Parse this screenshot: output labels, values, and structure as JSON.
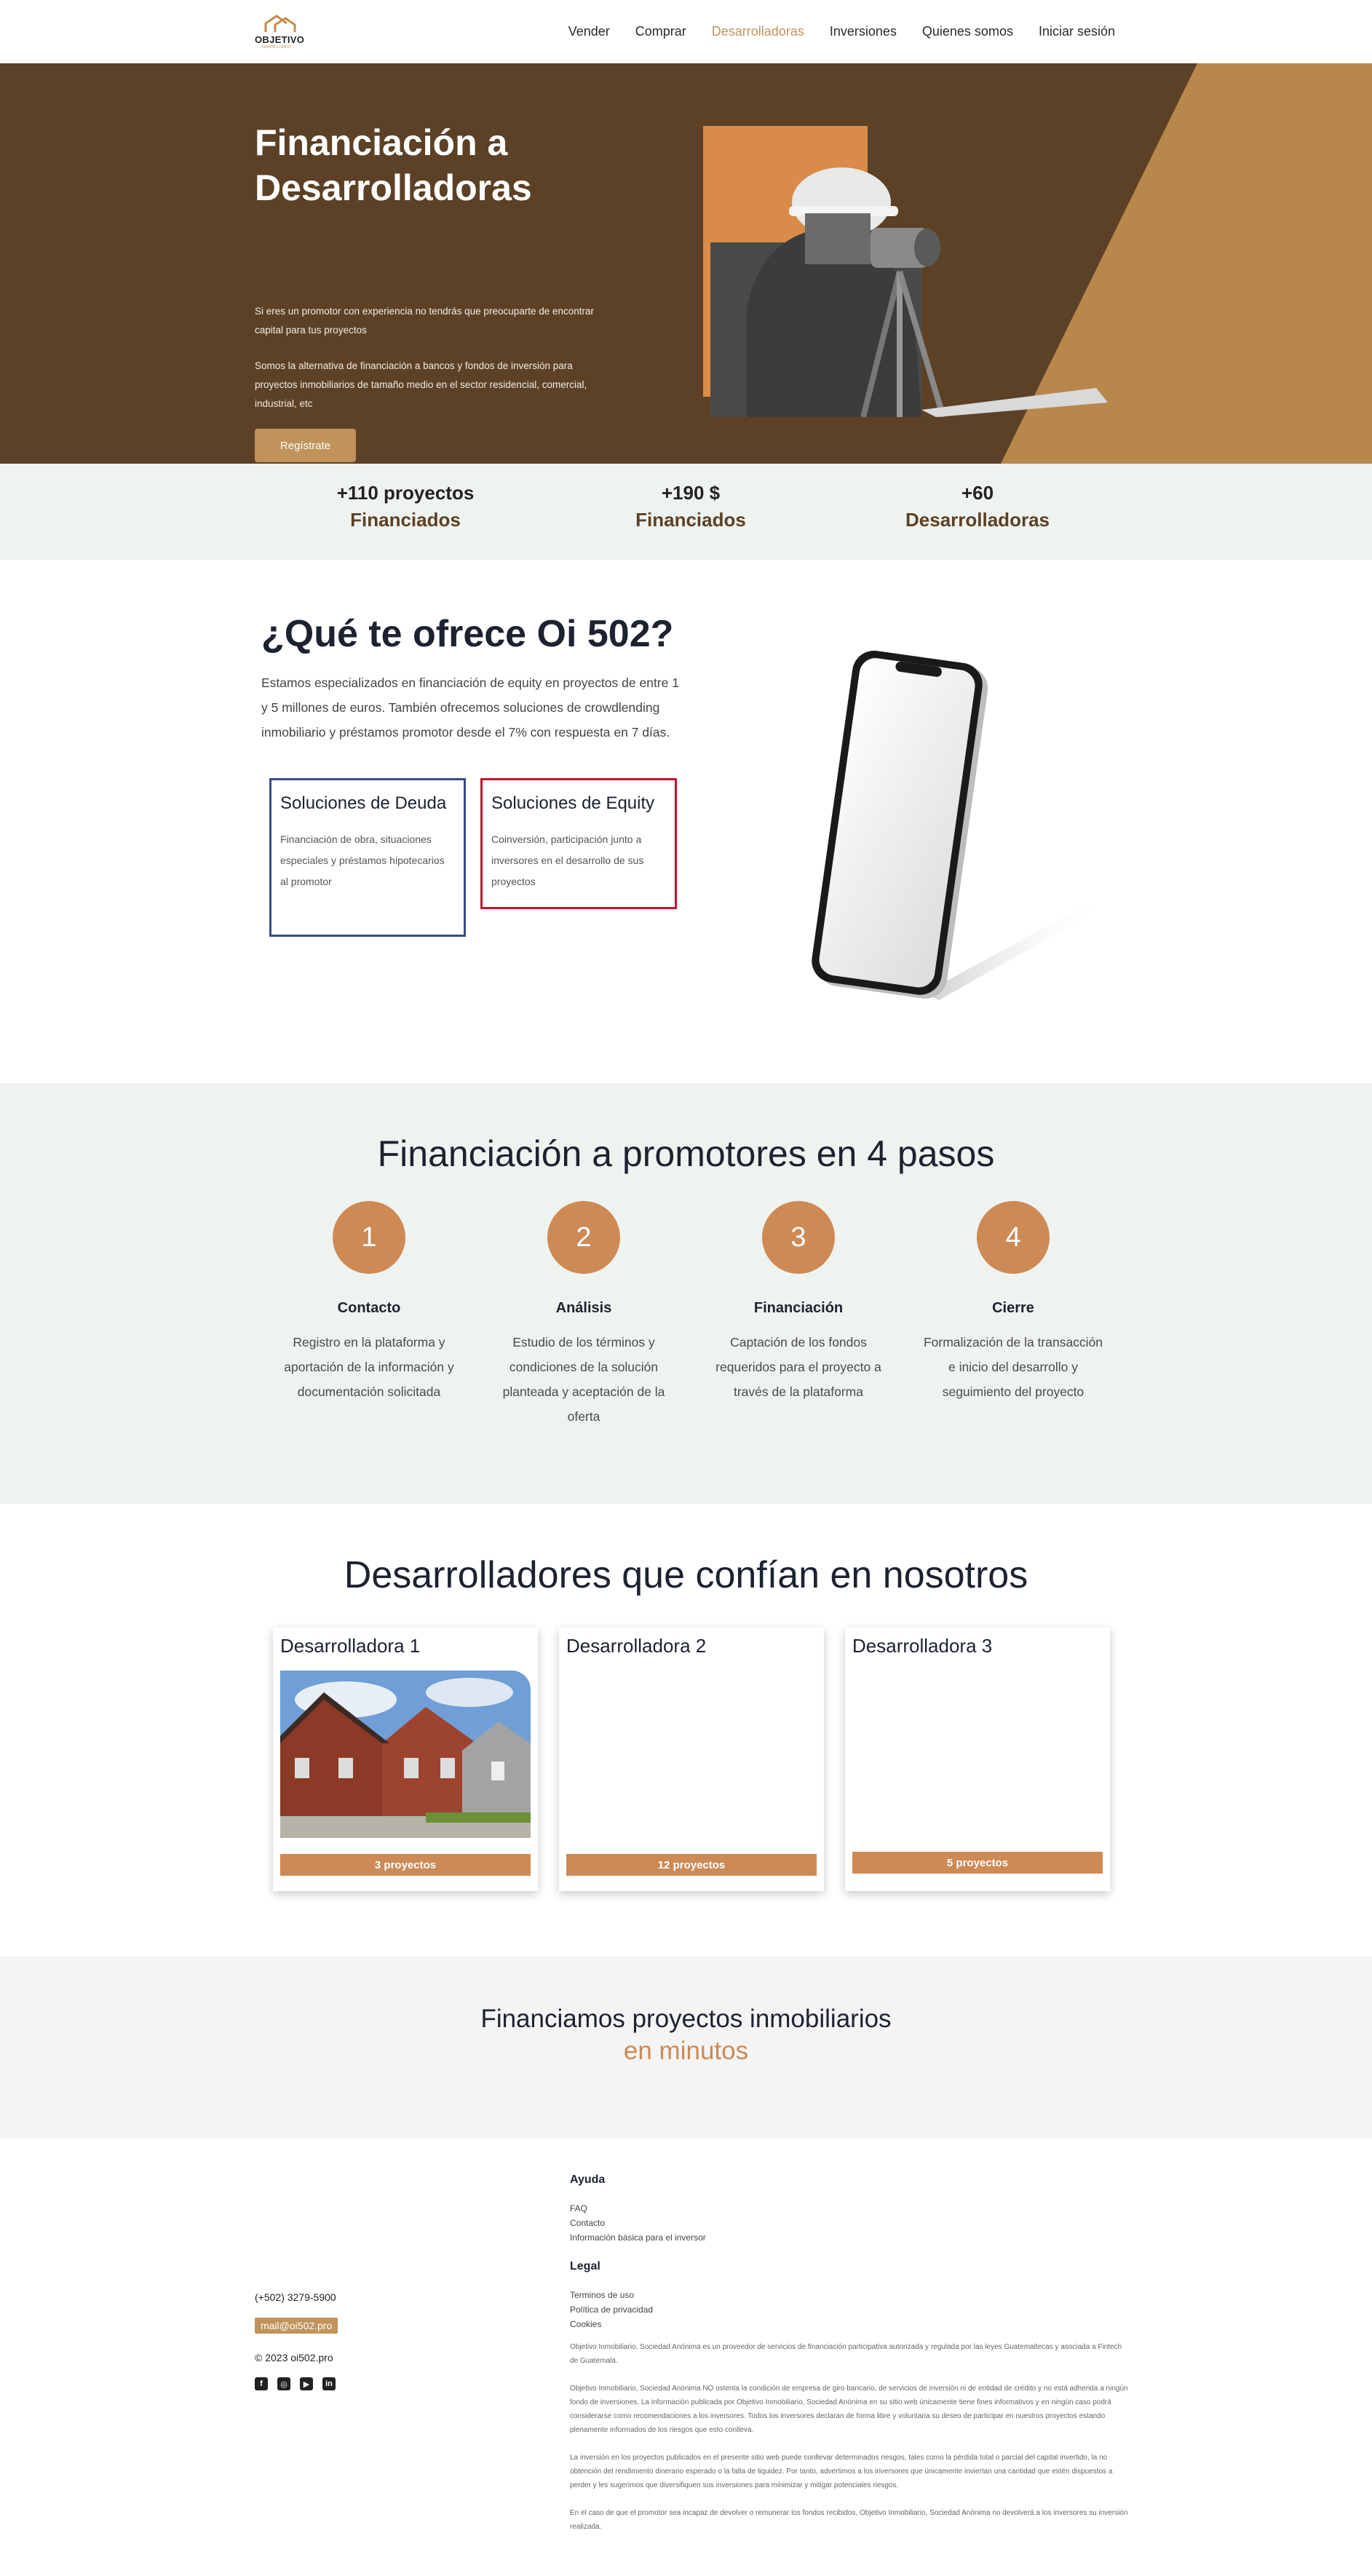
{
  "brand": {
    "name": "OBJETIVO",
    "tagline": "INMOBILIARIO",
    "accent": "#c0935a",
    "brown": "#5c4126",
    "orange": "#cd8a55"
  },
  "nav": {
    "items": [
      {
        "label": "Vender",
        "active": false
      },
      {
        "label": "Comprar",
        "active": false
      },
      {
        "label": "Desarrolladoras",
        "active": true
      },
      {
        "label": "Inversiones",
        "active": false
      },
      {
        "label": "Quienes somos",
        "active": false
      },
      {
        "label": "Iniciar sesión",
        "active": false
      }
    ]
  },
  "hero": {
    "title": "Financiación a Desarrolladoras",
    "p1": "Si eres un promotor con experiencia no tendrás que preocuparte de encontrar capital para tus proyectos",
    "p2": "Somos la alternativa de financiación a bancos y fondos de inversión para proyectos inmobiliarios de tamaño medio en el sector residencial, comercial, industrial, etc",
    "button": "Regístrate"
  },
  "stats": [
    {
      "num": "+110 proyectos",
      "label": "Financiados"
    },
    {
      "num": "+190 $",
      "label": "Financiados"
    },
    {
      "num": "+60",
      "label": "Desarrolladoras"
    }
  ],
  "offer": {
    "title": "¿Qué te ofrece Oi 502?",
    "intro": "Estamos especializados en financiación de equity en proyectos de entre 1 y 5 millones de euros. También ofrecemos soluciones de crowdlending inmobiliario y préstamos promotor desde el 7% con respuesta en 7 días.",
    "cards": [
      {
        "title": "Soluciones de Deuda",
        "text": "Financiación de obra, situaciones especiales y préstamos hipotecarios al promotor"
      },
      {
        "title": "Soluciones de Equity",
        "text": "Coinversión, participación junto a inversores en el desarrollo de sus proyectos"
      }
    ]
  },
  "steps": {
    "title": "Financiación a promotores en 4 pasos",
    "items": [
      {
        "n": "1",
        "title": "Contacto",
        "text": "Registro en la plataforma y aportación de la información y documentación solicitada"
      },
      {
        "n": "2",
        "title": "Análisis",
        "text": "Estudio de los términos y condiciones de la solución planteada y aceptación de la oferta"
      },
      {
        "n": "3",
        "title": "Financiación",
        "text": "Captación de los fondos requeridos para el proyecto a través de la plataforma"
      },
      {
        "n": "4",
        "title": "Cierre",
        "text": "Formalización de la transacción e inicio del desarrollo y seguimiento del proyecto"
      }
    ]
  },
  "devs": {
    "title": "Desarrolladores que confían en nosotros",
    "cards": [
      {
        "name": "Desarrolladora 1",
        "projects": "3 proyectos"
      },
      {
        "name": "Desarrolladora 2",
        "projects": "12 proyectos"
      },
      {
        "name": "Desarrolladora 3",
        "projects": "5 proyectos"
      }
    ]
  },
  "cta": {
    "line1": "Financiamos proyectos inmobiliarios",
    "line2": "en minutos"
  },
  "footer": {
    "phone": "(+502) 3279-5900",
    "email": "mail@oi502.pro",
    "copyright": "© 2023 oi502.pro",
    "help_title": "Ayuda",
    "help_links": [
      "FAQ",
      "Contacto",
      "Información básica para el inversor"
    ],
    "legal_title": "Legal",
    "legal_links": [
      "Terminos de uso",
      "Política de privacidad",
      "Cookies"
    ],
    "legal_texts": [
      "Objetivo Inmobiliario, Sociedad Anónima es un proveedor de servicios de financiación participativa autorizada y regulada por las leyes Guatemaltecas y asociada a Fintech de Guatemala.",
      "Objetivo Inmobiliario, Sociedad Anónima NO ostenta la condición de empresa de giro bancario, de servicios de inversión ni de entidad de crédito y no está adherida a ningún fondo de inversiones. La información publicada por Objetivo Inmobiliario, Sociedad Anónima en su sitio web únicamente tiene fines informativos y en ningún caso podrá considerarse como recomendaciones a los inversores. Todos los inversores declaran de forma libre y voluntaria su deseo de participar en nuestros proyectos estando plenamente informados de los riesgos que esto conlleva.",
      "La inversión en los proyectos publicados en el presente sitio web puede conllevar determinados riesgos, tales como la pérdida total o parcial del capital invertido, la no obtención del rendimiento dinerario esperado o la falta de liquidez. Por tanto, advertimos a los inversores que únicamente inviertan una cantidad que estén dispuestos a perder y les sugerimos que diversifiquen sus inversiones para minimizar y mitigar potenciales riesgos.",
      "En el caso de que el promotor sea incapaz de devolver o remunerar los fondos recibidos, Objetivo Inmobiliario, Sociedad Anónima no devolverá a los inversores su inversión realizada."
    ]
  }
}
